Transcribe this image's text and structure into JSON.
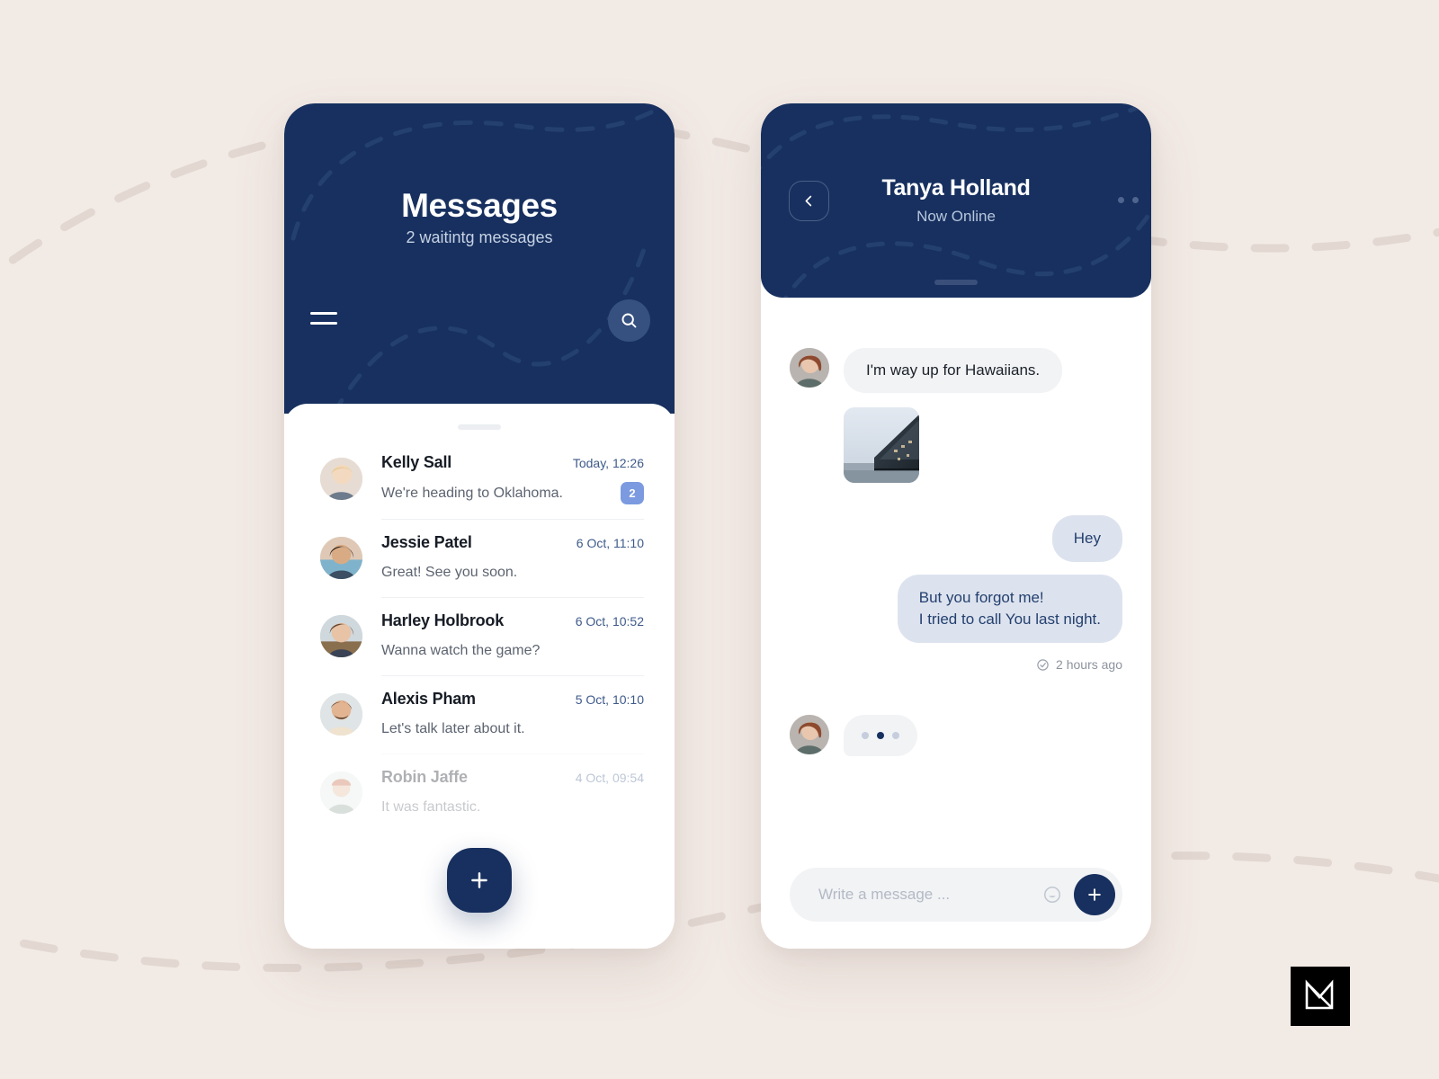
{
  "theme": {
    "background": "#f2eae5",
    "navy": "#17305f",
    "navy_light": "#36507f",
    "card": "#ffffff",
    "badge_blue": "#7b9ae0",
    "bubble_in": "#f2f3f5",
    "bubble_out": "#dde3ee",
    "text_dark": "#171c25",
    "text_muted": "#5d6470",
    "time_blue": "#3e5a8a"
  },
  "messages_screen": {
    "title": "Messages",
    "subtitle": "2 waitintg messages",
    "menu_icon": "hamburger-icon",
    "search_icon": "search-icon",
    "drag_handle": "drag-handle",
    "fab_icon": "plus-icon",
    "conversations": [
      {
        "name": "Kelly Sall",
        "time": "Today, 12:26",
        "preview": "We're heading to Oklahoma.",
        "badge": "2",
        "avatar": "avatar-kelly-sall"
      },
      {
        "name": "Jessie Patel",
        "time": "6 Oct, 11:10",
        "preview": "Great! See you soon.",
        "badge": "",
        "avatar": "avatar-jessie-patel"
      },
      {
        "name": "Harley Holbrook",
        "time": "6 Oct, 10:52",
        "preview": "Wanna watch the game?",
        "badge": "",
        "avatar": "avatar-harley-holbrook"
      },
      {
        "name": "Alexis Pham",
        "time": "5 Oct, 10:10",
        "preview": "Let's talk later about it.",
        "badge": "",
        "avatar": "avatar-alexis-pham"
      },
      {
        "name": "Robin Jaffe",
        "time": "4 Oct, 09:54",
        "preview": "It was fantastic.",
        "badge": "",
        "avatar": "avatar-robin-jaffe"
      }
    ]
  },
  "chat_screen": {
    "contact_name": "Tanya Holland",
    "contact_status": "Now Online",
    "back_icon": "chevron-left-icon",
    "more_icon": "more-options-icon",
    "drag_handle": "drag-handle",
    "messages": [
      {
        "kind": "text",
        "direction": "incoming",
        "text": "I'm way up for Hawaiians.",
        "avatar": "avatar-tanya-holland"
      },
      {
        "kind": "image",
        "direction": "incoming",
        "alt": "waterfront-building-photo"
      },
      {
        "kind": "text",
        "direction": "outgoing",
        "text": "Hey"
      },
      {
        "kind": "text",
        "direction": "outgoing",
        "line1": "But you forgot me!",
        "line2": "I tried to call You last night."
      }
    ],
    "delivery": {
      "status_icon": "check-circle-icon",
      "timestamp": "2 hours ago"
    },
    "typing_indicator": {
      "avatar": "avatar-tanya-holland",
      "dots": 3
    },
    "composer": {
      "placeholder": "Write a message ...",
      "value": "",
      "emoji_icon": "emoji-icon",
      "send_icon": "plus-icon"
    }
  },
  "branding": {
    "logo": "m-monogram-logo"
  }
}
